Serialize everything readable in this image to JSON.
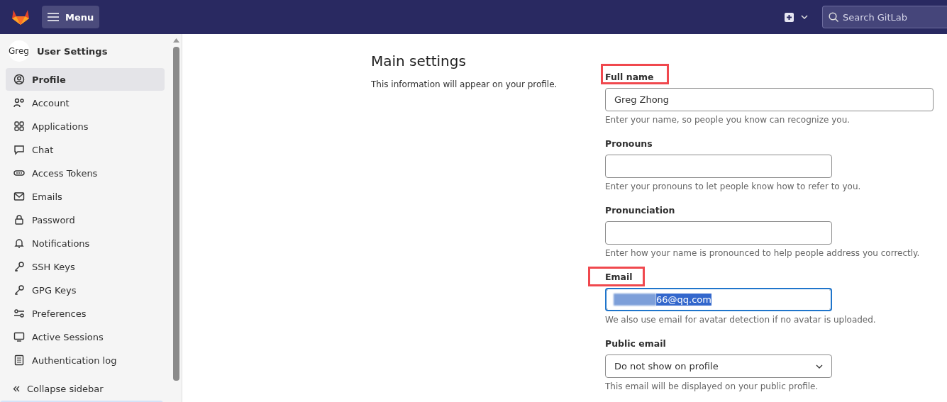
{
  "topbar": {
    "menu_label": "Menu",
    "search": {
      "placeholder": "Search GitLab"
    }
  },
  "sidebar": {
    "avatar_text": "Greg",
    "title": "User Settings",
    "items": [
      {
        "label": "Profile",
        "selected": true
      },
      {
        "label": "Account",
        "selected": false
      },
      {
        "label": "Applications",
        "selected": false
      },
      {
        "label": "Chat",
        "selected": false
      },
      {
        "label": "Access Tokens",
        "selected": false
      },
      {
        "label": "Emails",
        "selected": false
      },
      {
        "label": "Password",
        "selected": false
      },
      {
        "label": "Notifications",
        "selected": false
      },
      {
        "label": "SSH Keys",
        "selected": false
      },
      {
        "label": "GPG Keys",
        "selected": false
      },
      {
        "label": "Preferences",
        "selected": false
      },
      {
        "label": "Active Sessions",
        "selected": false
      },
      {
        "label": "Authentication log",
        "selected": false
      }
    ],
    "collapse_label": "Collapse sidebar"
  },
  "section": {
    "title": "Main settings",
    "description": "This information will appear on your profile."
  },
  "fields": [
    {
      "kind": "text",
      "label": "Full name",
      "highlighted": true,
      "value": "Greg Zhong",
      "help": "Enter your name, so people you know can recognize you."
    },
    {
      "kind": "text",
      "label": "Pronouns",
      "highlighted": false,
      "help": "Enter your pronouns to let people know how to refer to you."
    },
    {
      "kind": "text",
      "label": "Pronunciation",
      "highlighted": false,
      "help": "Enter how your name is pronounced to help people address you correctly."
    },
    {
      "kind": "email",
      "label": "Email",
      "highlighted": true,
      "value": "66@qq.com",
      "help": "We also use email for avatar detection if no avatar is uploaded."
    },
    {
      "kind": "select",
      "label": "Public email",
      "highlighted": false,
      "value": "Do not show on profile",
      "help": "This email will be displayed on your public profile."
    }
  ]
}
